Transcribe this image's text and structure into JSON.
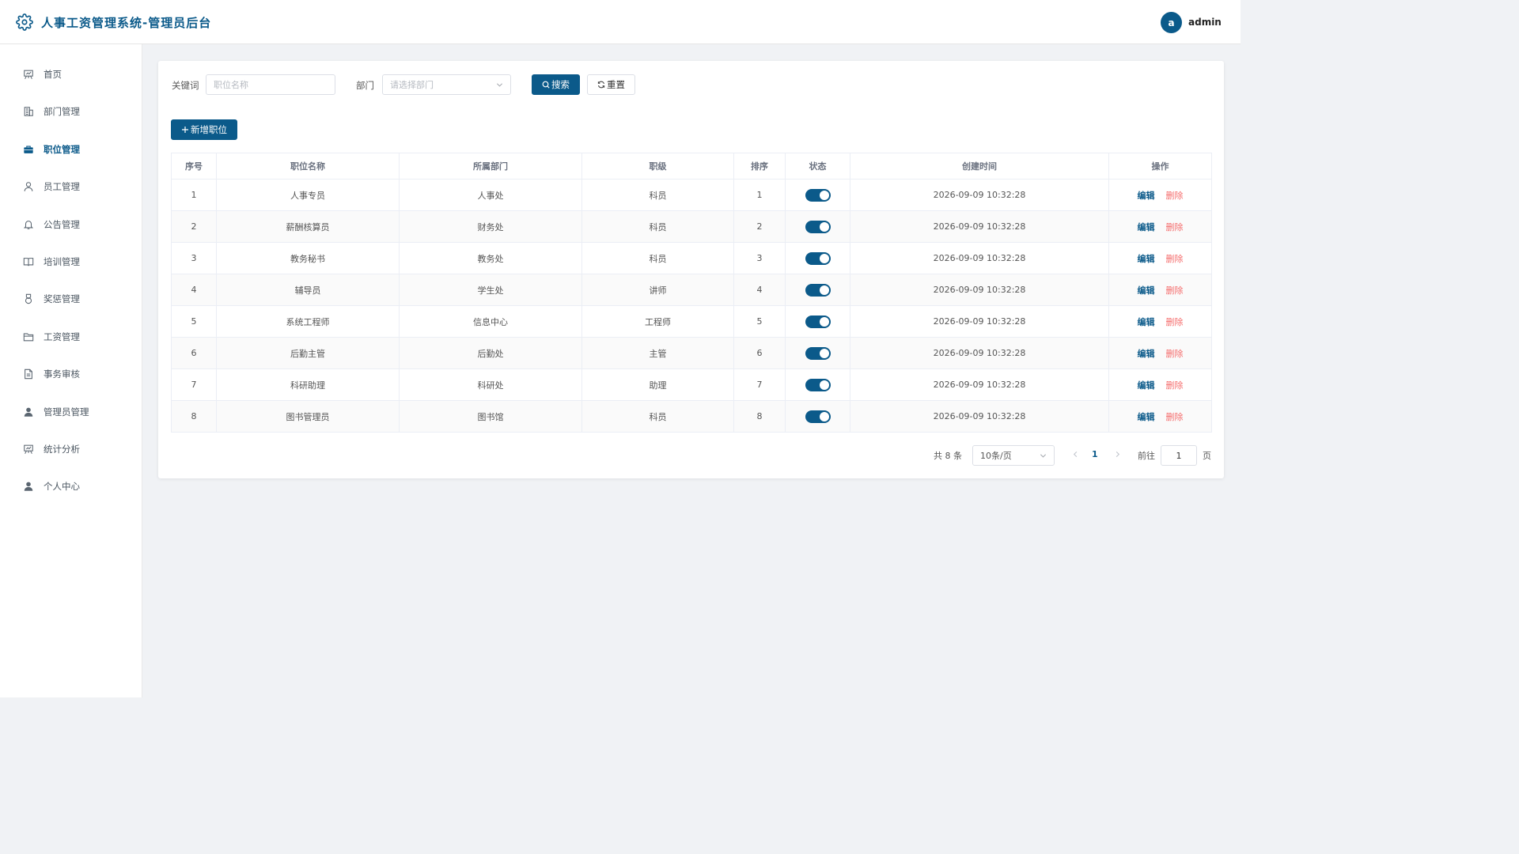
{
  "header": {
    "title": "人事工资管理系统-管理员后台",
    "avatar_letter": "a",
    "username": "admin"
  },
  "sidebar": {
    "items": [
      {
        "label": "首页",
        "icon": "presentation-icon"
      },
      {
        "label": "部门管理",
        "icon": "building-icon"
      },
      {
        "label": "职位管理",
        "icon": "briefcase-icon",
        "active": true
      },
      {
        "label": "员工管理",
        "icon": "user-icon"
      },
      {
        "label": "公告管理",
        "icon": "bell-icon"
      },
      {
        "label": "培训管理",
        "icon": "book-icon"
      },
      {
        "label": "奖惩管理",
        "icon": "medal-icon"
      },
      {
        "label": "工资管理",
        "icon": "folder-icon"
      },
      {
        "label": "事务审核",
        "icon": "document-icon"
      },
      {
        "label": "管理员管理",
        "icon": "admin-user-icon"
      },
      {
        "label": "统计分析",
        "icon": "chart-board-icon"
      },
      {
        "label": "个人中心",
        "icon": "person-icon"
      }
    ]
  },
  "filters": {
    "keyword_label": "关键词",
    "keyword_placeholder": "职位名称",
    "keyword_value": "",
    "dept_label": "部门",
    "dept_placeholder": "请选择部门",
    "search_label": "搜索",
    "reset_label": "重置"
  },
  "actions": {
    "add_label": "新增职位"
  },
  "table": {
    "columns": [
      "序号",
      "职位名称",
      "所属部门",
      "职级",
      "排序",
      "状态",
      "创建时间",
      "操作"
    ],
    "rows": [
      {
        "no": "1",
        "name": "人事专员",
        "dept": "人事处",
        "level": "科员",
        "sort": "1",
        "status": true,
        "created": "2026-09-09 10:32:28"
      },
      {
        "no": "2",
        "name": "薪酬核算员",
        "dept": "财务处",
        "level": "科员",
        "sort": "2",
        "status": true,
        "created": "2026-09-09 10:32:28"
      },
      {
        "no": "3",
        "name": "教务秘书",
        "dept": "教务处",
        "level": "科员",
        "sort": "3",
        "status": true,
        "created": "2026-09-09 10:32:28"
      },
      {
        "no": "4",
        "name": "辅导员",
        "dept": "学生处",
        "level": "讲师",
        "sort": "4",
        "status": true,
        "created": "2026-09-09 10:32:28"
      },
      {
        "no": "5",
        "name": "系统工程师",
        "dept": "信息中心",
        "level": "工程师",
        "sort": "5",
        "status": true,
        "created": "2026-09-09 10:32:28"
      },
      {
        "no": "6",
        "name": "后勤主管",
        "dept": "后勤处",
        "level": "主管",
        "sort": "6",
        "status": true,
        "created": "2026-09-09 10:32:28"
      },
      {
        "no": "7",
        "name": "科研助理",
        "dept": "科研处",
        "level": "助理",
        "sort": "7",
        "status": true,
        "created": "2026-09-09 10:32:28"
      },
      {
        "no": "8",
        "name": "图书管理员",
        "dept": "图书馆",
        "level": "科员",
        "sort": "8",
        "status": true,
        "created": "2026-09-09 10:32:28"
      }
    ],
    "edit_label": "编辑",
    "delete_label": "删除"
  },
  "pagination": {
    "total_text": "共 8 条",
    "page_size": "10条/页",
    "current_page": "1",
    "goto_label": "前往",
    "goto_value": "1",
    "page_unit": "页"
  },
  "colors": {
    "primary": "#0b5a8a",
    "danger": "#f56c6c",
    "background": "#f0f2f5"
  }
}
